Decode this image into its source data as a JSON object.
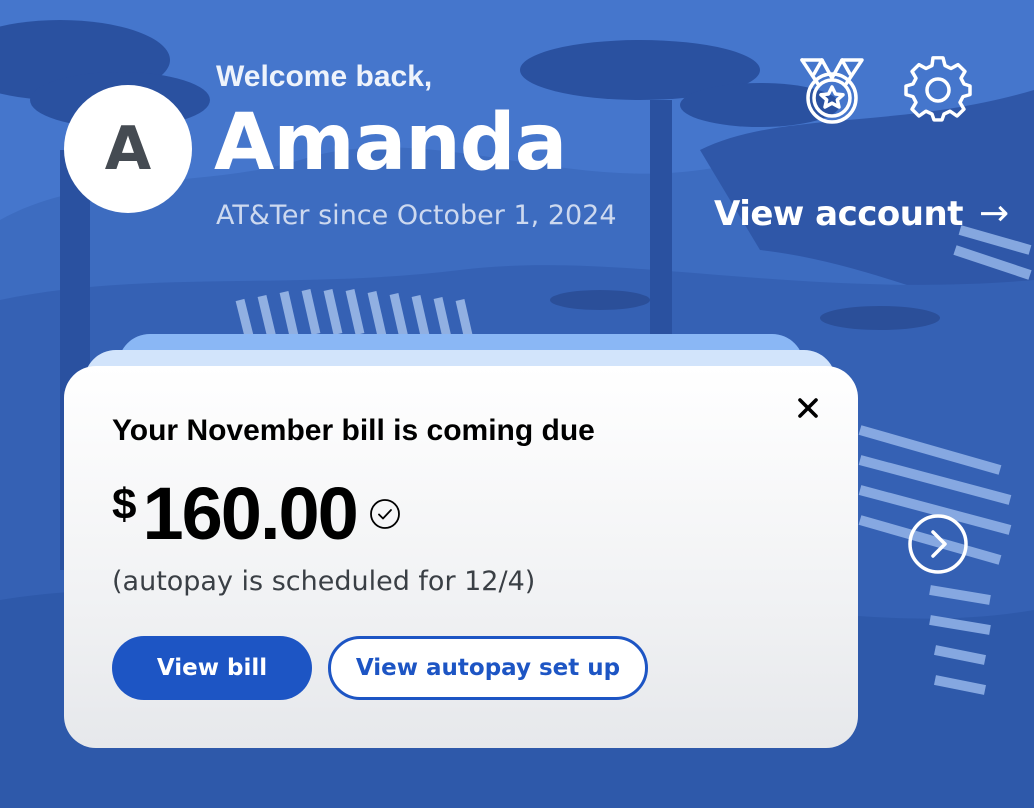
{
  "header": {
    "greeting": "Welcome back,",
    "name": "Amanda",
    "avatar_initial": "A",
    "member_since": "AT&Ter since October 1, 2024",
    "view_account_label": "View account",
    "view_account_arrow": "→",
    "icons": [
      "medal-icon",
      "gear-icon",
      "arrow-right-icon"
    ]
  },
  "bill_card": {
    "title": "Your November bill is coming due",
    "currency": "$",
    "amount": "160.00",
    "autopay_note": "(autopay is scheduled for  12/4)",
    "primary_button": "View bill",
    "secondary_button": "View autopay set up",
    "icons": [
      "close-icon",
      "check-circle-icon",
      "chevron-right-circle-icon"
    ]
  },
  "colors": {
    "background": "#3a67b8",
    "accent": "#1d55c4",
    "card": "#ffffff",
    "stack_back": "#8ab7f5",
    "stack_mid": "#d2e4fb"
  }
}
